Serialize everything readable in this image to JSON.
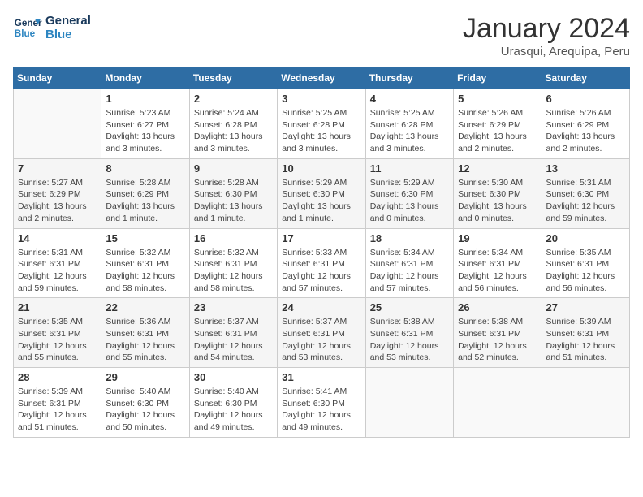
{
  "logo": {
    "line1": "General",
    "line2": "Blue"
  },
  "title": "January 2024",
  "location": "Urasqui, Arequipa, Peru",
  "days_of_week": [
    "Sunday",
    "Monday",
    "Tuesday",
    "Wednesday",
    "Thursday",
    "Friday",
    "Saturday"
  ],
  "weeks": [
    [
      {
        "num": "",
        "info": ""
      },
      {
        "num": "1",
        "info": "Sunrise: 5:23 AM\nSunset: 6:27 PM\nDaylight: 13 hours\nand 3 minutes."
      },
      {
        "num": "2",
        "info": "Sunrise: 5:24 AM\nSunset: 6:28 PM\nDaylight: 13 hours\nand 3 minutes."
      },
      {
        "num": "3",
        "info": "Sunrise: 5:25 AM\nSunset: 6:28 PM\nDaylight: 13 hours\nand 3 minutes."
      },
      {
        "num": "4",
        "info": "Sunrise: 5:25 AM\nSunset: 6:28 PM\nDaylight: 13 hours\nand 3 minutes."
      },
      {
        "num": "5",
        "info": "Sunrise: 5:26 AM\nSunset: 6:29 PM\nDaylight: 13 hours\nand 2 minutes."
      },
      {
        "num": "6",
        "info": "Sunrise: 5:26 AM\nSunset: 6:29 PM\nDaylight: 13 hours\nand 2 minutes."
      }
    ],
    [
      {
        "num": "7",
        "info": "Sunrise: 5:27 AM\nSunset: 6:29 PM\nDaylight: 13 hours\nand 2 minutes."
      },
      {
        "num": "8",
        "info": "Sunrise: 5:28 AM\nSunset: 6:29 PM\nDaylight: 13 hours\nand 1 minute."
      },
      {
        "num": "9",
        "info": "Sunrise: 5:28 AM\nSunset: 6:30 PM\nDaylight: 13 hours\nand 1 minute."
      },
      {
        "num": "10",
        "info": "Sunrise: 5:29 AM\nSunset: 6:30 PM\nDaylight: 13 hours\nand 1 minute."
      },
      {
        "num": "11",
        "info": "Sunrise: 5:29 AM\nSunset: 6:30 PM\nDaylight: 13 hours\nand 0 minutes."
      },
      {
        "num": "12",
        "info": "Sunrise: 5:30 AM\nSunset: 6:30 PM\nDaylight: 13 hours\nand 0 minutes."
      },
      {
        "num": "13",
        "info": "Sunrise: 5:31 AM\nSunset: 6:30 PM\nDaylight: 12 hours\nand 59 minutes."
      }
    ],
    [
      {
        "num": "14",
        "info": "Sunrise: 5:31 AM\nSunset: 6:31 PM\nDaylight: 12 hours\nand 59 minutes."
      },
      {
        "num": "15",
        "info": "Sunrise: 5:32 AM\nSunset: 6:31 PM\nDaylight: 12 hours\nand 58 minutes."
      },
      {
        "num": "16",
        "info": "Sunrise: 5:32 AM\nSunset: 6:31 PM\nDaylight: 12 hours\nand 58 minutes."
      },
      {
        "num": "17",
        "info": "Sunrise: 5:33 AM\nSunset: 6:31 PM\nDaylight: 12 hours\nand 57 minutes."
      },
      {
        "num": "18",
        "info": "Sunrise: 5:34 AM\nSunset: 6:31 PM\nDaylight: 12 hours\nand 57 minutes."
      },
      {
        "num": "19",
        "info": "Sunrise: 5:34 AM\nSunset: 6:31 PM\nDaylight: 12 hours\nand 56 minutes."
      },
      {
        "num": "20",
        "info": "Sunrise: 5:35 AM\nSunset: 6:31 PM\nDaylight: 12 hours\nand 56 minutes."
      }
    ],
    [
      {
        "num": "21",
        "info": "Sunrise: 5:35 AM\nSunset: 6:31 PM\nDaylight: 12 hours\nand 55 minutes."
      },
      {
        "num": "22",
        "info": "Sunrise: 5:36 AM\nSunset: 6:31 PM\nDaylight: 12 hours\nand 55 minutes."
      },
      {
        "num": "23",
        "info": "Sunrise: 5:37 AM\nSunset: 6:31 PM\nDaylight: 12 hours\nand 54 minutes."
      },
      {
        "num": "24",
        "info": "Sunrise: 5:37 AM\nSunset: 6:31 PM\nDaylight: 12 hours\nand 53 minutes."
      },
      {
        "num": "25",
        "info": "Sunrise: 5:38 AM\nSunset: 6:31 PM\nDaylight: 12 hours\nand 53 minutes."
      },
      {
        "num": "26",
        "info": "Sunrise: 5:38 AM\nSunset: 6:31 PM\nDaylight: 12 hours\nand 52 minutes."
      },
      {
        "num": "27",
        "info": "Sunrise: 5:39 AM\nSunset: 6:31 PM\nDaylight: 12 hours\nand 51 minutes."
      }
    ],
    [
      {
        "num": "28",
        "info": "Sunrise: 5:39 AM\nSunset: 6:31 PM\nDaylight: 12 hours\nand 51 minutes."
      },
      {
        "num": "29",
        "info": "Sunrise: 5:40 AM\nSunset: 6:30 PM\nDaylight: 12 hours\nand 50 minutes."
      },
      {
        "num": "30",
        "info": "Sunrise: 5:40 AM\nSunset: 6:30 PM\nDaylight: 12 hours\nand 49 minutes."
      },
      {
        "num": "31",
        "info": "Sunrise: 5:41 AM\nSunset: 6:30 PM\nDaylight: 12 hours\nand 49 minutes."
      },
      {
        "num": "",
        "info": ""
      },
      {
        "num": "",
        "info": ""
      },
      {
        "num": "",
        "info": ""
      }
    ]
  ]
}
